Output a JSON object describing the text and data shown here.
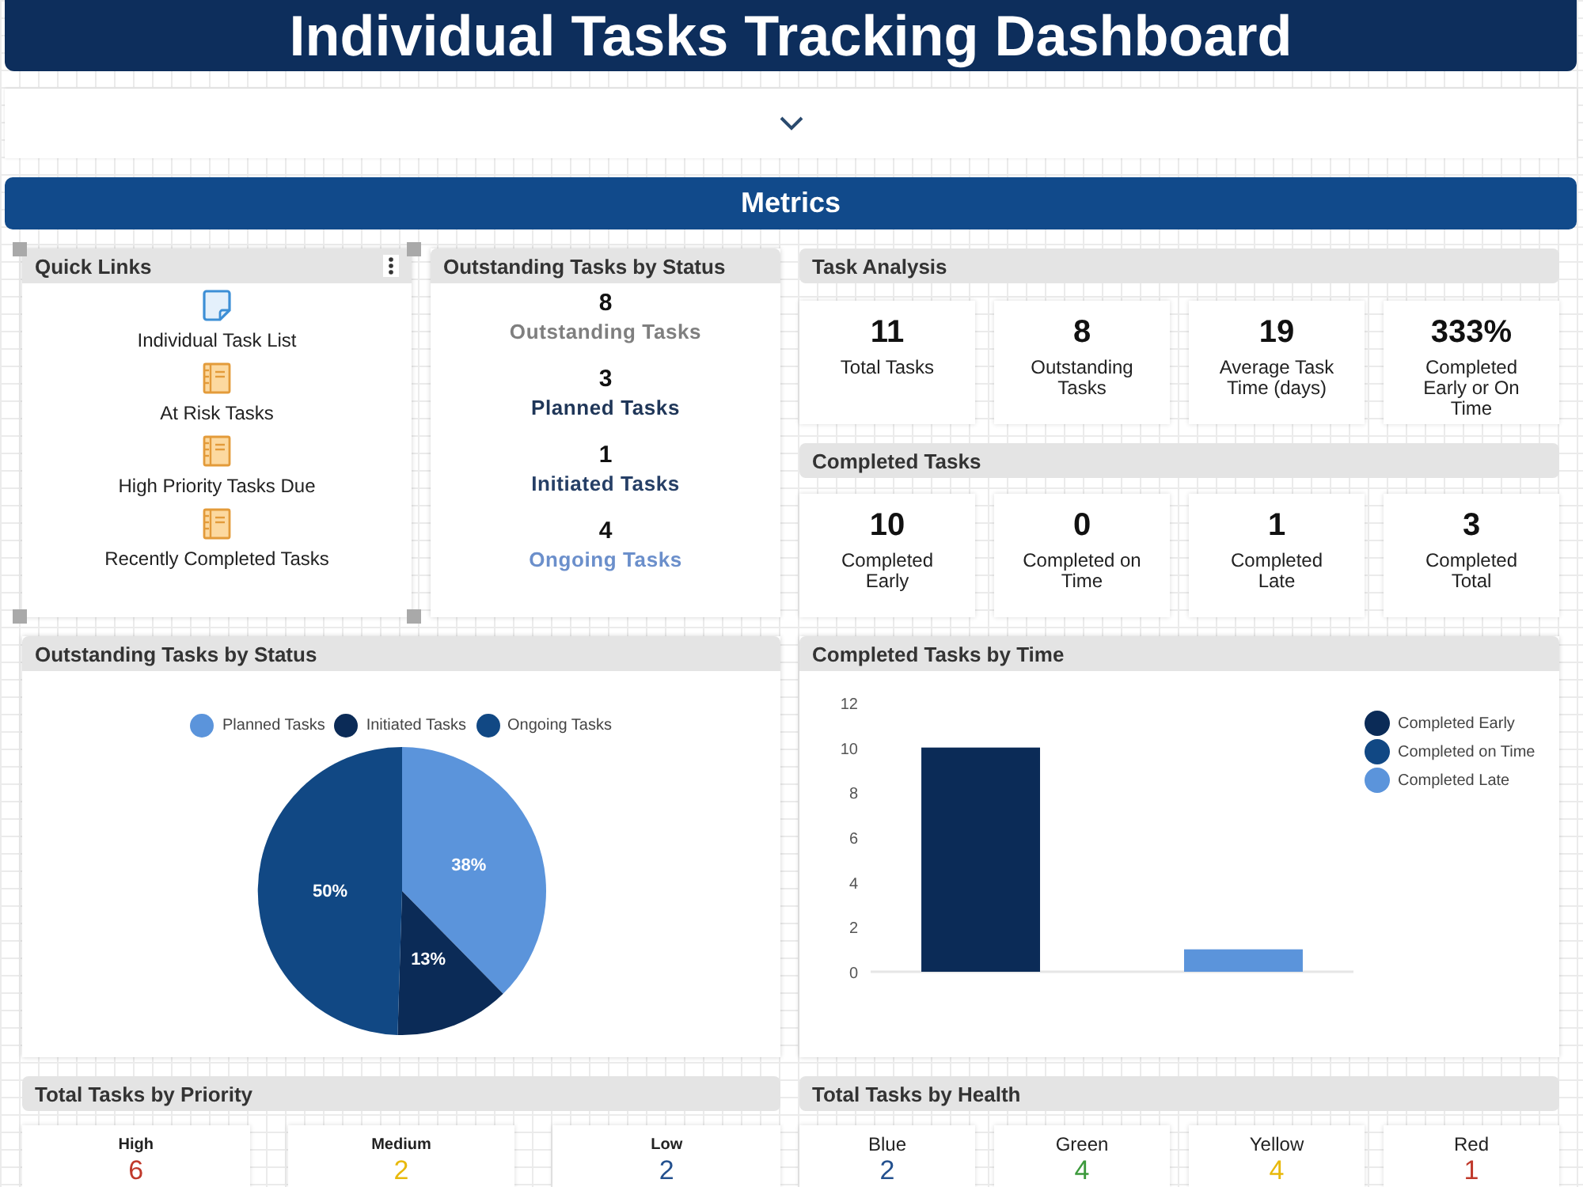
{
  "title": "Individual Tasks Tracking Dashboard",
  "section": {
    "title": "Metrics"
  },
  "quick_links": {
    "title": "Quick Links",
    "selected": true,
    "links": [
      {
        "label": "Individual Task List",
        "kind": "note"
      },
      {
        "label": "At Risk Tasks",
        "kind": "notebook"
      },
      {
        "label": "High Priority Tasks Due",
        "kind": "notebook"
      },
      {
        "label": "Recently Completed Tasks",
        "kind": "notebook"
      }
    ]
  },
  "status_summary": {
    "title": "Outstanding Tasks by Status",
    "items": [
      {
        "count": "8",
        "label": "Outstanding Tasks",
        "color": "#7f7f7f"
      },
      {
        "count": "3",
        "label": "Planned Tasks",
        "color": "#1f3658"
      },
      {
        "count": "1",
        "label": "Initiated Tasks",
        "color": "#263f66"
      },
      {
        "count": "4",
        "label": "Ongoing Tasks",
        "color": "#6b8fcb"
      }
    ]
  },
  "task_analysis": {
    "title": "Task Analysis",
    "tiles": [
      {
        "value": "11",
        "label": "Total Tasks"
      },
      {
        "value": "8",
        "label": "Outstanding Tasks"
      },
      {
        "value": "19",
        "label": "Average Task Time (days)"
      },
      {
        "value": "333%",
        "label": "Completed Early or On Time"
      }
    ]
  },
  "completed_tasks": {
    "title": "Completed Tasks",
    "tiles": [
      {
        "value": "10",
        "label": "Completed Early"
      },
      {
        "value": "0",
        "label": "Completed on Time"
      },
      {
        "value": "1",
        "label": "Completed Late"
      },
      {
        "value": "3",
        "label": "Completed Total"
      }
    ]
  },
  "status_chart": {
    "title": "Outstanding Tasks by Status",
    "slices": [
      {
        "color": "#5b94db"
      },
      {
        "color": "#0b2b57"
      },
      {
        "color": "#114884"
      }
    ],
    "chart_data": {
      "type": "pie",
      "categories": [
        "Planned Tasks",
        "Initiated Tasks",
        "Ongoing Tasks"
      ],
      "values": [
        38,
        13,
        50
      ],
      "value_labels": [
        "38%",
        "13%",
        "50%"
      ],
      "legend": true
    }
  },
  "time_chart": {
    "title": "Completed Tasks by Time",
    "chart_data": {
      "type": "bar",
      "series": [
        {
          "name": "Completed Early",
          "color": "#0b2b57",
          "values": [
            10
          ]
        },
        {
          "name": "Completed on Time",
          "color": "#114884",
          "values": [
            0
          ]
        },
        {
          "name": "Completed Late",
          "color": "#5b94db",
          "values": [
            1
          ]
        }
      ],
      "ylim": [
        0,
        12
      ],
      "yticks": [
        {
          "value": 0,
          "label": "0"
        },
        {
          "value": 2,
          "label": "2"
        },
        {
          "value": 4,
          "label": "4"
        },
        {
          "value": 6,
          "label": "6"
        },
        {
          "value": 8,
          "label": "8"
        },
        {
          "value": 10,
          "label": "10"
        },
        {
          "value": 12,
          "label": "12"
        }
      ],
      "legend": true
    }
  },
  "priority": {
    "title": "Total Tasks by Priority",
    "tiles": [
      {
        "label": "High",
        "value": "6",
        "color": "#c0392b"
      },
      {
        "label": "Medium",
        "value": "2",
        "color": "#e8b90c"
      },
      {
        "label": "Low",
        "value": "2",
        "color": "#23508e"
      }
    ]
  },
  "health": {
    "title": "Total Tasks by Health",
    "tiles": [
      {
        "label": "Blue",
        "value": "2",
        "color": "#23508e"
      },
      {
        "label": "Green",
        "value": "4",
        "color": "#3c9a3c"
      },
      {
        "label": "Yellow",
        "value": "4",
        "color": "#e8b90c"
      },
      {
        "label": "Red",
        "value": "1",
        "color": "#c0392b"
      }
    ]
  }
}
